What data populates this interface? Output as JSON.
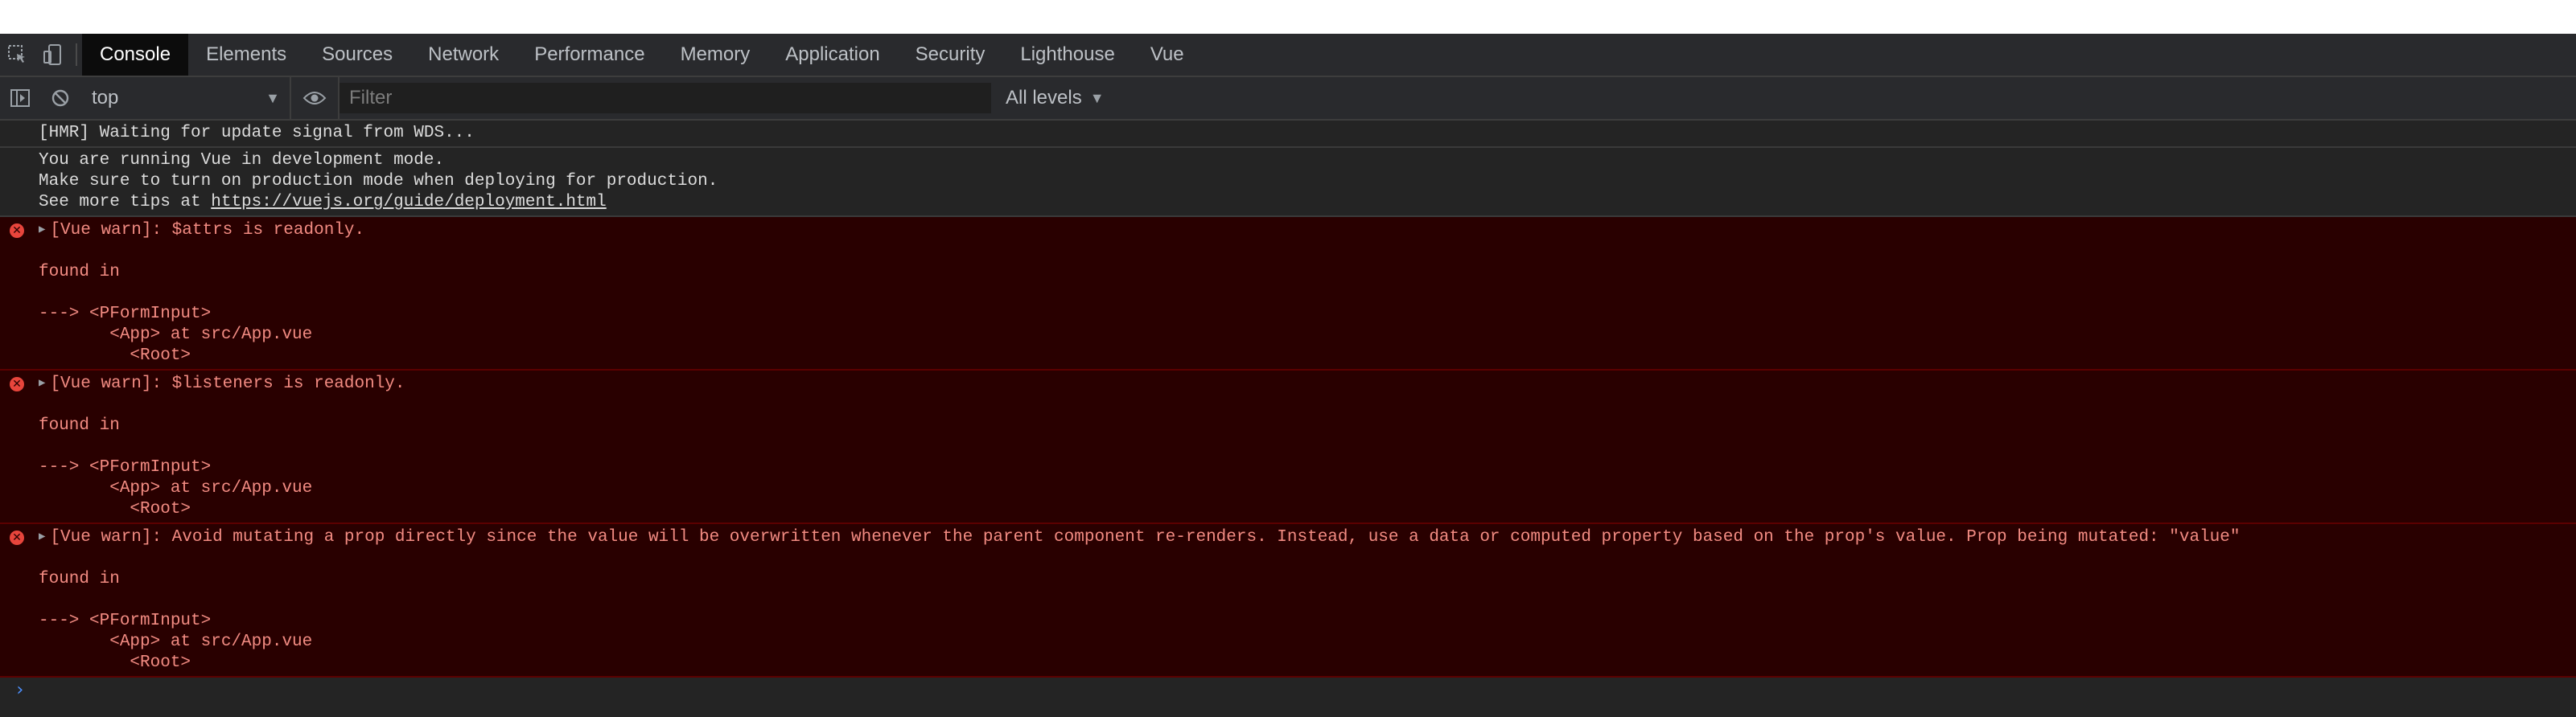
{
  "tabs": [
    {
      "label": "Console"
    },
    {
      "label": "Elements"
    },
    {
      "label": "Sources"
    },
    {
      "label": "Network"
    },
    {
      "label": "Performance"
    },
    {
      "label": "Memory"
    },
    {
      "label": "Application"
    },
    {
      "label": "Security"
    },
    {
      "label": "Lighthouse"
    },
    {
      "label": "Vue"
    }
  ],
  "active_tab": "Console",
  "toolbar": {
    "context": "top",
    "filter_placeholder": "Filter",
    "levels_label": "All levels"
  },
  "messages": {
    "hmr": "[HMR] Waiting for update signal from WDS...",
    "vue_dev_line1": "You are running Vue in development mode.",
    "vue_dev_line2": "Make sure to turn on production mode when deploying for production.",
    "vue_dev_line3_prefix": "See more tips at ",
    "vue_dev_link": "https://vuejs.org/guide/deployment.html",
    "warn1": "[Vue warn]: $attrs is readonly.",
    "warn2": "[Vue warn]: $listeners is readonly.",
    "warn3": "[Vue warn]: Avoid mutating a prop directly since the value will be overwritten whenever the parent component re-renders. Instead, use a data or computed property based on the prop's value. Prop being mutated: \"value\"",
    "found_in": "found in",
    "trace1": "---> <PFormInput>",
    "trace2": "       <App> at src/App.vue",
    "trace3": "         <Root>"
  },
  "prompt_symbol": "›",
  "colors": {
    "error_bg": "#290000",
    "error_text": "#f28b82",
    "error_icon": "#e8453c",
    "prompt": "#4d90fe"
  }
}
